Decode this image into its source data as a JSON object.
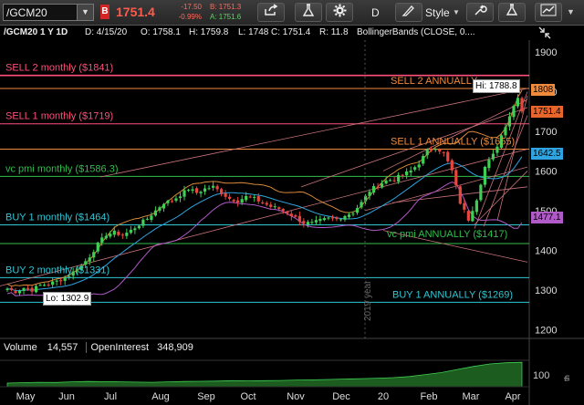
{
  "toolbar": {
    "symbol": "/GCM20",
    "flag": "B",
    "last_price": "1751.4",
    "net_change": "-17.50",
    "pct_change": "-0.99%",
    "bid": "B: 1751.3",
    "ask": "A: 1751.6",
    "timeframe_button": "D",
    "style_label": "Style"
  },
  "header": {
    "symbol_period": "/GCM20 1 Y 1D",
    "date": "D: 4/15/20",
    "open": "O: 1758.1",
    "high": "H: 1759.8",
    "low": "L: 1748",
    "close": "C: 1751.4",
    "range": "R: 11.8",
    "study": "BollingerBands (CLOSE, 0...."
  },
  "levels": [
    {
      "label": "SELL 2 monthly ($1841)",
      "price": 1841,
      "color": "#ff4f7a"
    },
    {
      "label": "SELL 2 ANNUALLY",
      "price": 1808,
      "color": "#f08a3c"
    },
    {
      "label": "SELL 1 monthly ($1719)",
      "price": 1719,
      "color": "#ff4f7a"
    },
    {
      "label": "SELL 1 ANNUALLY ($1655)",
      "price": 1655,
      "color": "#f08a3c"
    },
    {
      "label": "vc pmi monthly ($1586.3)",
      "price": 1586.3,
      "color": "#2fbf4c"
    },
    {
      "label": "BUY 1 monthly ($1464)",
      "price": 1464,
      "color": "#2ec7d6"
    },
    {
      "label": "vc pmi ANNUALLY ($1417)",
      "price": 1417,
      "color": "#2fbf4c"
    },
    {
      "label": "BUY 2 monthly ($1331)",
      "price": 1331,
      "color": "#2ec7d6"
    },
    {
      "label": "BUY 1 ANNUALLY ($1269)",
      "price": 1269,
      "color": "#2ec7d6"
    }
  ],
  "price_tags": {
    "hi": "Hi: 1788.8",
    "lo": "Lo: 1302.9",
    "sell2_annual": "1808",
    "last": "1751.4",
    "bb_upper": "1642.5",
    "bb_lower": "1477.1"
  },
  "year_marker": "2019 year",
  "volume_panel": {
    "volume_label": "Volume",
    "volume_value": "14,557",
    "oi_label": "OpenInterest",
    "oi_value": "348,909",
    "axis_label": "100",
    "axis_unit": "th"
  },
  "chart_data": {
    "type": "candlestick",
    "title": "/GCM20 1 Y 1D",
    "ylim": [
      1180,
      1930
    ],
    "y_ticks": [
      1200,
      1300,
      1400,
      1500,
      1600,
      1700,
      1800,
      1900
    ],
    "x_tick_labels": [
      "May",
      "Jun",
      "Jul",
      "Aug",
      "Sep",
      "Oct",
      "Nov",
      "Dec",
      "20",
      "Feb",
      "Mar",
      "Apr"
    ],
    "close_path": [
      [
        0,
        1302.9
      ],
      [
        2,
        1296
      ],
      [
        4,
        1305
      ],
      [
        6,
        1300
      ],
      [
        8,
        1312
      ],
      [
        10,
        1315
      ],
      [
        12,
        1322
      ],
      [
        14,
        1330
      ],
      [
        16,
        1345
      ],
      [
        18,
        1360
      ],
      [
        20,
        1385
      ],
      [
        22,
        1415
      ],
      [
        24,
        1440
      ],
      [
        26,
        1445
      ],
      [
        28,
        1438
      ],
      [
        30,
        1450
      ],
      [
        32,
        1465
      ],
      [
        34,
        1480
      ],
      [
        36,
        1500
      ],
      [
        38,
        1520
      ],
      [
        40,
        1525
      ],
      [
        42,
        1540
      ],
      [
        44,
        1555
      ],
      [
        46,
        1545
      ],
      [
        48,
        1555
      ],
      [
        50,
        1560
      ],
      [
        52,
        1545
      ],
      [
        54,
        1530
      ],
      [
        56,
        1525
      ],
      [
        58,
        1535
      ],
      [
        60,
        1530
      ],
      [
        62,
        1520
      ],
      [
        64,
        1510
      ],
      [
        66,
        1505
      ],
      [
        68,
        1495
      ],
      [
        70,
        1482
      ],
      [
        72,
        1470
      ],
      [
        74,
        1468
      ],
      [
        76,
        1475
      ],
      [
        78,
        1480
      ],
      [
        80,
        1478
      ],
      [
        82,
        1488
      ],
      [
        84,
        1495
      ],
      [
        86,
        1520
      ],
      [
        88,
        1550
      ],
      [
        90,
        1565
      ],
      [
        92,
        1575
      ],
      [
        94,
        1580
      ],
      [
        96,
        1590
      ],
      [
        98,
        1600
      ],
      [
        100,
        1620
      ],
      [
        102,
        1650
      ],
      [
        104,
        1660
      ],
      [
        106,
        1645
      ],
      [
        108,
        1600
      ],
      [
        110,
        1520
      ],
      [
        112,
        1478
      ],
      [
        114,
        1530
      ],
      [
        116,
        1610
      ],
      [
        118,
        1640
      ],
      [
        120,
        1690
      ],
      [
        122,
        1740
      ],
      [
        124,
        1788.8
      ],
      [
        125,
        1751.4
      ]
    ],
    "volume": [
      18,
      20,
      22,
      21,
      24,
      26,
      25,
      24,
      23,
      22,
      24,
      26,
      27,
      28,
      30,
      29,
      30,
      31,
      33,
      34,
      36,
      38,
      40,
      42,
      45,
      50,
      60,
      70,
      85,
      100,
      112,
      118,
      120
    ]
  }
}
